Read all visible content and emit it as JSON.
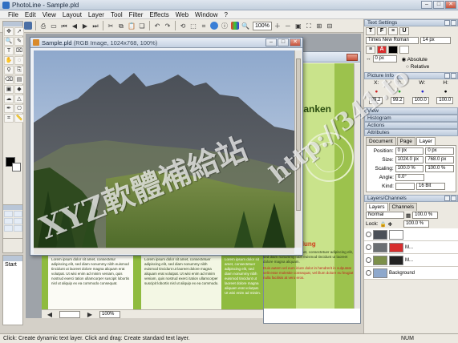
{
  "window": {
    "title": "PhotoLine - Sample.pld"
  },
  "menu": [
    "File",
    "Edit",
    "View",
    "Layout",
    "Layer",
    "Tool",
    "Filter",
    "Effects",
    "Web",
    "Window",
    "?"
  ],
  "toolbar": {
    "zoom": "100%"
  },
  "tools": {
    "icons": [
      "move-tool-icon",
      "cursor-tool-icon",
      "zoom-tool-icon",
      "brush-tool-icon",
      "text-tool-icon",
      "text-frame-tool-icon",
      "hand-tool-icon",
      "lasso-tool-icon",
      "eyedropper-tool-icon",
      "clone-tool-icon",
      "eraser-tool-icon",
      "gradient-tool-icon",
      "fill-tool-icon",
      "shape-tool-icon",
      "smudge-tool-icon",
      "sharpen-tool-icon",
      "pen-tool-icon",
      "stamp-tool-icon",
      "crop-tool-icon",
      "measure-tool-icon"
    ],
    "fg_color": "#000000",
    "bg_color": "#ffffff"
  },
  "history": {
    "title": "Start"
  },
  "document": {
    "title": "Sample.pld",
    "info": "(RGB Image, 1024x768, 100%)"
  },
  "layout_doc": {
    "heading": "Kraft tanken",
    "red_heading": "Einladung",
    "footer": {
      "page_field": "",
      "zoom_field": "100%"
    },
    "col1_text": "Lorem ipsum dolor sit amet, consectetur adipiscing elit, sed diam nonummy nibh euismod tincidunt ut laoreet dolore magna aliquam erat volutpat. Ut wisi enim ad minim veniam, quis nostrud exerci tation ullamcorper suscipit lobortis nisl ut aliquip ex ea commodo consequat.",
    "col2_text": "Lorem ipsum dolor sit amet, consectetuer adipiscing elit, sed diam nonummy nibh euismod tincidunt ut laoreet dolore magna aliquam erat volutpat. Ut wisi enim ad minim veniam, quis nostrud exerci tation ullamcorper suscipit lobortis nisl ut aliquip ex ea commodo.",
    "col3_text": "Lorem ipsum dolor sit amet, consectetuer adipiscing elit, sed diam nonummy nibh euismod tincidunt ut laoreet dolore magna aliquam erat volutpat. Ut wisi enim ad minim.",
    "col4_red": "Duis autem vel eum iriure dolor in hendrerit in vulputate velit esse molestie consequat, vel illum dolore eu feugiat nulla facilisis at vero eros.",
    "col4_text": "Lorem ipsum dolor sit amet, consectetuer adipiscing elit, sed diam nonummy nibh euismod tincidunt ut laoreet dolore magna aliquam."
  },
  "text_settings": {
    "title": "Text Settings",
    "font": "Times New Roman",
    "size": "14 px",
    "spacing": "0 px",
    "absolute": "Absolute",
    "relative": "Relative"
  },
  "picture_info": {
    "title": "Picture Info",
    "labels": [
      "X:",
      "Y:",
      "W:",
      "H:"
    ],
    "values": [
      "99.2",
      "99.2",
      "100.0",
      "100.0"
    ]
  },
  "panels": [
    "View",
    "Histogram",
    "Actions",
    "Attributes"
  ],
  "attributes": {
    "tabs": [
      "Document",
      "Page",
      "Layer"
    ],
    "position_label": "Position:",
    "position_x": "0 px",
    "position_y": "0 px",
    "size_label": "Size:",
    "size_w": "1024.0 px",
    "size_h": "768.0 px",
    "scaling_label": "Scaling:",
    "scaling_x": "100.0 %",
    "scaling_y": "100.0 %",
    "angle_label": "Angle:",
    "angle": "0.0°",
    "kind_label": "Kind:",
    "kind": "16 Bit"
  },
  "layers_panel": {
    "title": "Layers/Channels",
    "tabs": [
      "Layers",
      "Channels"
    ],
    "mode": "Normal",
    "opacity": "100.0 %",
    "lock_label": "Lock:",
    "opacity2": "100.0 %",
    "rows": [
      {
        "name": ""
      },
      {
        "name": "M..."
      },
      {
        "name": "M..."
      },
      {
        "name": "Background"
      }
    ]
  },
  "status": {
    "text": "Click: Create dynamic text layer. Click and drag: Create standard text layer.",
    "num": "NUM"
  },
  "watermark": {
    "line1": "XYZ軟體補給站",
    "line2": "http://341.to"
  }
}
